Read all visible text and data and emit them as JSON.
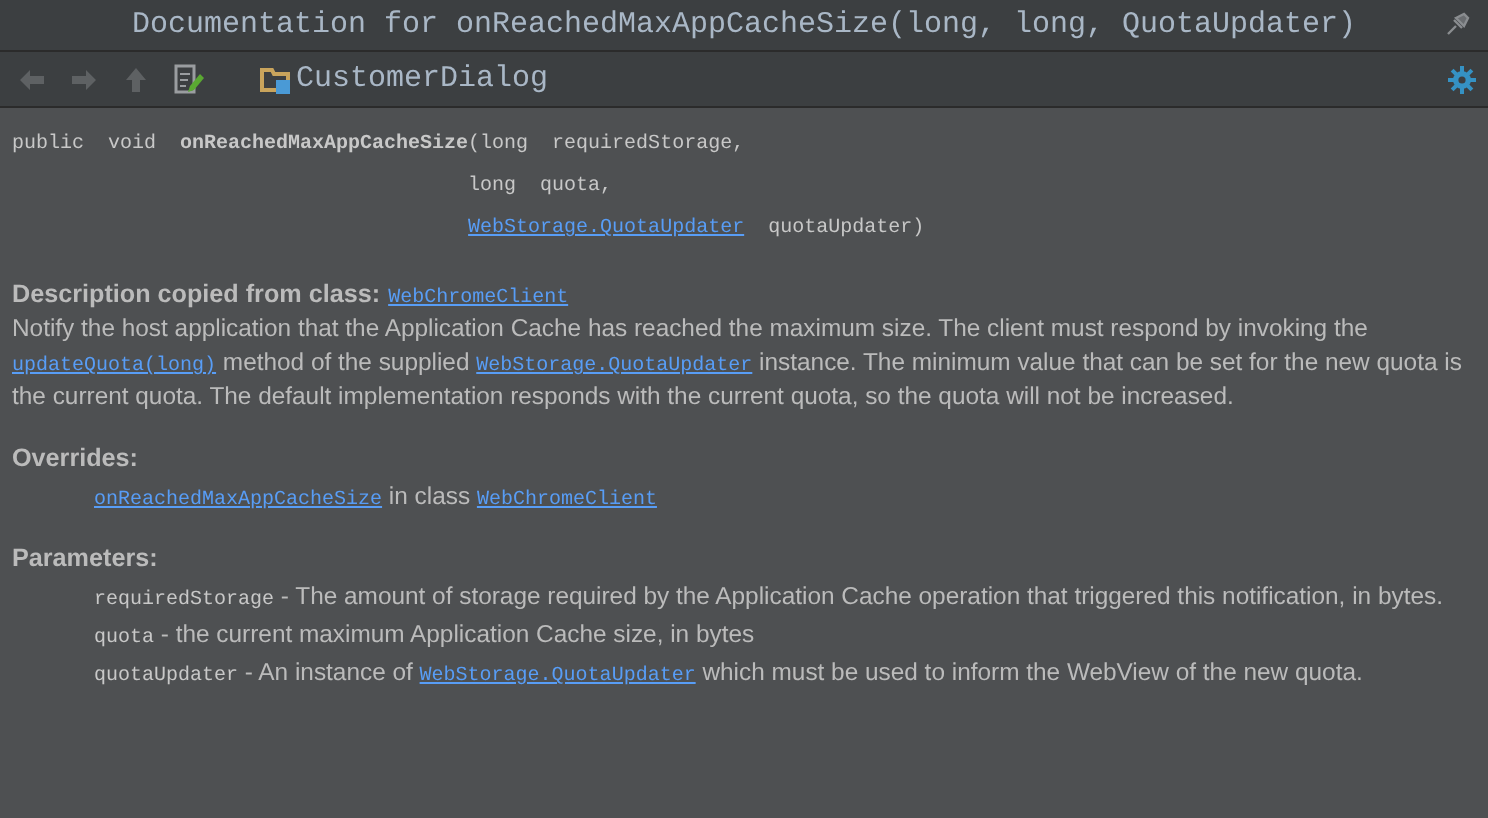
{
  "window": {
    "title": "Documentation for onReachedMaxAppCacheSize(long, long, QuotaUpdater)"
  },
  "toolbar": {
    "buttons": [
      {
        "kind": "back",
        "disabled": true
      },
      {
        "kind": "forward",
        "disabled": true
      },
      {
        "kind": "up",
        "disabled": true
      },
      {
        "kind": "edit",
        "disabled": false
      }
    ],
    "breadcrumb": "CustomerDialog"
  },
  "signature": {
    "modifiers": "public  void",
    "name": "onReachedMaxAppCacheSize",
    "lines": [
      [
        {
          "kind": "text",
          "text": "(long  requiredStorage,"
        }
      ],
      [
        {
          "kind": "text",
          "text": "long  quota,"
        }
      ],
      [
        {
          "kind": "link",
          "text": "WebStorage.QuotaUpdater"
        },
        {
          "kind": "text",
          "text": "  quotaUpdater)"
        }
      ]
    ]
  },
  "sections": [
    {
      "heading": "Description copied from class:",
      "heading_link": "WebChromeClient",
      "indented": false,
      "paragraphs": [
        [
          {
            "kind": "text",
            "text": "Notify the host application that the Application Cache has reached the maximum size. The client must respond by invoking the "
          },
          {
            "kind": "link",
            "text": "updateQuota(long)"
          },
          {
            "kind": "text",
            "text": " method of the supplied "
          },
          {
            "kind": "link",
            "text": "WebStorage.QuotaUpdater"
          },
          {
            "kind": "text",
            "text": " instance. The minimum value that can be set for the new quota is the current quota. The default implementation responds with the current quota, so the quota will not be increased."
          }
        ]
      ]
    },
    {
      "heading": "Overrides:",
      "indented": true,
      "paragraphs": [
        [
          {
            "kind": "link",
            "text": "onReachedMaxAppCacheSize"
          },
          {
            "kind": "text",
            "text": " in class "
          },
          {
            "kind": "link",
            "text": "WebChromeClient"
          }
        ]
      ]
    },
    {
      "heading": "Parameters:",
      "indented": true,
      "paragraphs": [
        [
          {
            "kind": "code",
            "text": "requiredStorage"
          },
          {
            "kind": "text",
            "text": " - The amount of storage required by the Application Cache operation that triggered this notification, in bytes."
          }
        ],
        [
          {
            "kind": "code",
            "text": "quota"
          },
          {
            "kind": "text",
            "text": " - the current maximum Application Cache size, in bytes"
          }
        ],
        [
          {
            "kind": "code",
            "text": "quotaUpdater"
          },
          {
            "kind": "text",
            "text": " - An instance of "
          },
          {
            "kind": "link",
            "text": "WebStorage.QuotaUpdater"
          },
          {
            "kind": "text",
            "text": " which must be used to inform the WebView of the new quota."
          }
        ]
      ]
    }
  ]
}
